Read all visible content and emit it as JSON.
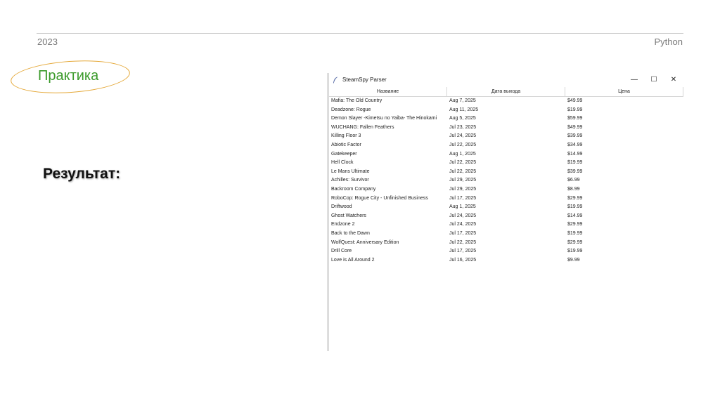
{
  "slide": {
    "year": "2023",
    "lang": "Python",
    "practice": "Практика",
    "result": "Результат:"
  },
  "window": {
    "title": "SteamSpy Parser",
    "controls": {
      "min": "—",
      "max": "☐",
      "close": "✕"
    }
  },
  "table": {
    "headers": [
      "Название",
      "Дата выхода",
      "Цена"
    ],
    "rows": [
      [
        "Mafia: The Old Country",
        "Aug 7, 2025",
        "$49.99"
      ],
      [
        "Deadzone: Rogue",
        "Aug 11, 2025",
        "$19.99"
      ],
      [
        "Demon Slayer -Kimetsu no Yaiba- The Hinokami",
        "Aug 5, 2025",
        "$59.99"
      ],
      [
        "WUCHANG: Fallen Feathers",
        "Jul 23, 2025",
        "$49.99"
      ],
      [
        "Killing Floor 3",
        "Jul 24, 2025",
        "$39.99"
      ],
      [
        "Abiotic Factor",
        "Jul 22, 2025",
        "$34.99"
      ],
      [
        "Gatekeeper",
        "Aug 1, 2025",
        "$14.99"
      ],
      [
        "Hell Clock",
        "Jul 22, 2025",
        "$19.99"
      ],
      [
        "Le Mans Ultimate",
        "Jul 22, 2025",
        "$39.99"
      ],
      [
        "Achilles: Survivor",
        "Jul 29, 2025",
        "$6.99"
      ],
      [
        "Backroom Company",
        "Jul 29, 2025",
        "$8.99"
      ],
      [
        "RoboCop: Rogue City - Unfinished Business",
        "Jul 17, 2025",
        "$29.99"
      ],
      [
        "Driftwood",
        "Aug 1, 2025",
        "$19.99"
      ],
      [
        "Ghost Watchers",
        "Jul 24, 2025",
        "$14.99"
      ],
      [
        "Endzone 2",
        "Jul 24, 2025",
        "$29.99"
      ],
      [
        "Back to the Dawn",
        "Jul 17, 2025",
        "$19.99"
      ],
      [
        "WolfQuest: Anniversary Edition",
        "Jul 22, 2025",
        "$29.99"
      ],
      [
        "Drill Core",
        "Jul 17, 2025",
        "$19.99"
      ],
      [
        "Love is All Around 2",
        "Jul 16, 2025",
        "$9.99"
      ]
    ]
  }
}
